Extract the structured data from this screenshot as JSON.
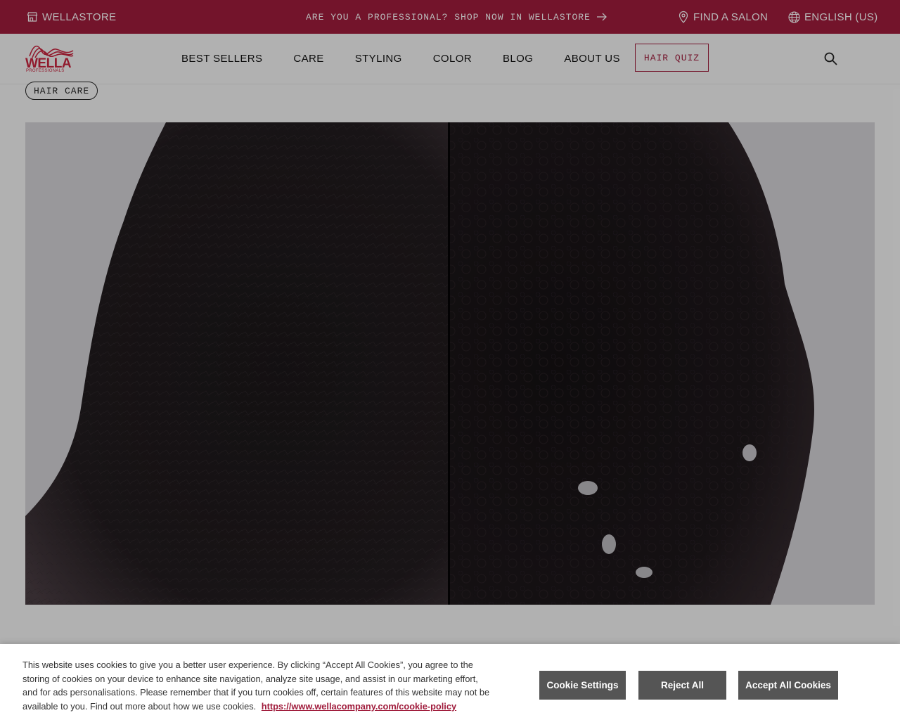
{
  "topbar": {
    "store_label": "WELLASTORE",
    "promo_text": "ARE YOU A PROFESSIONAL? SHOP NOW IN WELLASTORE",
    "salon_label": "FIND A SALON",
    "language_label": "ENGLISH (US)",
    "background_color": "#a01c3c"
  },
  "header": {
    "logo": {
      "wordmark": "WELLA",
      "sub": "PROFESSIONALS",
      "color": "#c9243f"
    },
    "nav": [
      "BEST SELLERS",
      "CARE",
      "STYLING",
      "COLOR",
      "BLOG",
      "ABOUT US"
    ],
    "quiz_label": "HAIR QUIZ",
    "search_icon": "search-icon"
  },
  "tag": {
    "label": "HAIR CARE"
  },
  "hero": {
    "image": "before-and-after curly hair comparison",
    "icons": []
  },
  "cookie": {
    "text": "This website uses cookies to give you a better user experience. By clicking “Accept All Cookies”, you agree to the storing of cookies on your device to enhance site navigation, analyze site usage, and assist in our marketing effort, and for ads personalisations. Please remember that if you turn cookies off, certain features of this website may not be available to you. Find out more about how we use cookies.",
    "link": "https://www.wellacompany.com/cookie-policy",
    "settings_label": "Cookie Settings",
    "reject_label": "Reject All",
    "accept_label": "Accept All Cookies",
    "button_color": "#555555"
  }
}
